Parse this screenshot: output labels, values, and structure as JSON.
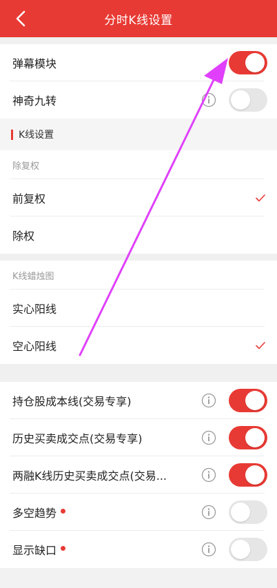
{
  "header": {
    "title": "分时K线设置",
    "back_icon": "chevron-left-icon"
  },
  "top_rows": [
    {
      "label": "弹幕模块",
      "toggle": "on",
      "info": false
    },
    {
      "label": "神奇九转",
      "toggle": "off",
      "info": true
    }
  ],
  "kline_section": {
    "title": "K线设置",
    "adjust_group": {
      "subheading": "除复权",
      "options": [
        {
          "label": "前复权",
          "checked": true
        },
        {
          "label": "除权",
          "checked": false
        }
      ]
    },
    "candle_group": {
      "subheading": "K线蜡烛图",
      "options": [
        {
          "label": "实心阳线",
          "checked": false
        },
        {
          "label": "空心阳线",
          "checked": true
        }
      ]
    }
  },
  "bottom_rows": [
    {
      "label": "持仓股成本线(交易专享)",
      "toggle": "on",
      "dot": false
    },
    {
      "label": "历史买卖成交点(交易专享)",
      "toggle": "on",
      "dot": false
    },
    {
      "label": "两融K线历史买卖成交点(交易...",
      "toggle": "on",
      "dot": false
    },
    {
      "label": "多空趋势",
      "toggle": "off",
      "dot": true
    },
    {
      "label": "显示缺口",
      "toggle": "off",
      "dot": true
    }
  ],
  "colors": {
    "accent": "#e83a34",
    "arrow": "#e040fb",
    "toggle_off": "#e6e6e6"
  }
}
